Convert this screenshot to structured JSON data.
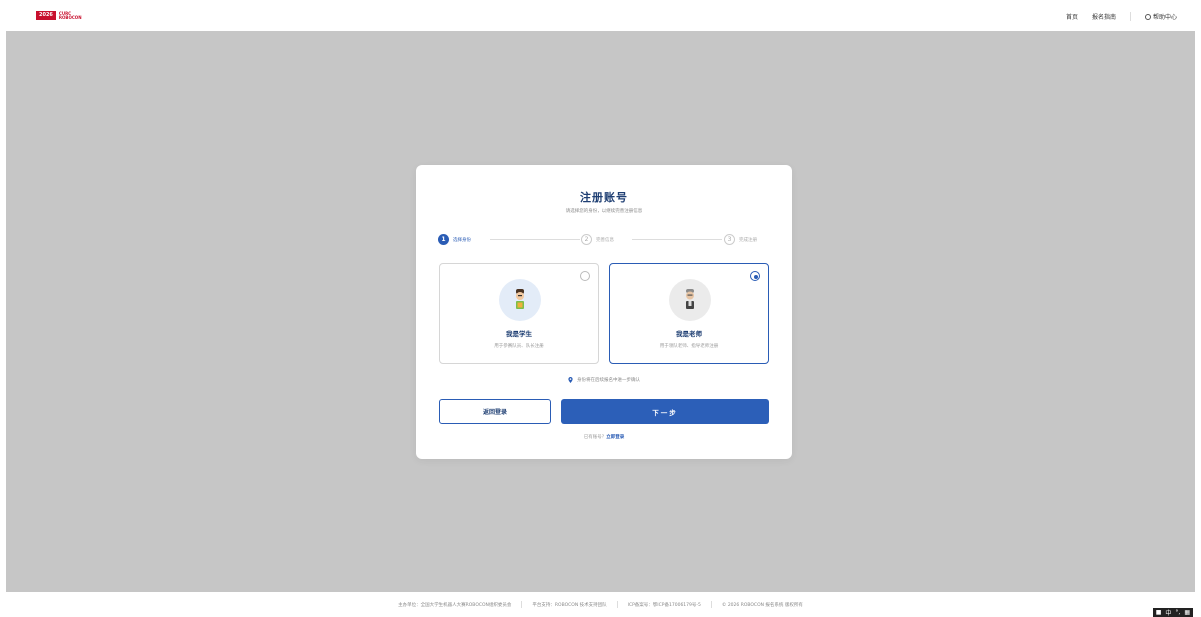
{
  "header": {
    "logo_badge": "2026",
    "logo_line1": "CURC",
    "logo_line2": "ROBOCON",
    "nav": {
      "home": "首页",
      "guide": "报名指南",
      "help": "帮助中心"
    }
  },
  "card": {
    "title": "注册账号",
    "subtitle": "请选择您的身份，以继续完善注册信息",
    "steps": [
      {
        "num": "1",
        "label": "选择身份"
      },
      {
        "num": "2",
        "label": "完善信息"
      },
      {
        "num": "3",
        "label": "完成注册"
      }
    ],
    "roles": {
      "student": {
        "name": "我是学生",
        "desc": "用于参赛队员、队长注册"
      },
      "teacher": {
        "name": "我是老师",
        "desc": "用于领队老师、指导老师注册"
      }
    },
    "selected_role": "teacher",
    "note": "身份将在后续报名中进一步确认",
    "back_button": "返回登录",
    "next_button": "下一步",
    "login_prompt": "已有账号？",
    "login_link": "立即登录"
  },
  "footer": {
    "organizer": "主办单位：全国大学生机器人大赛ROBOCON组织委员会",
    "support": "平台支持：ROBOCON 技术支持团队",
    "icp": "ICP备案号：鄂ICP备17006179号-5",
    "copyright": "© 2026 ROBOCON 报名系统 版权所有"
  },
  "ime": {
    "label": "中"
  },
  "colors": {
    "accent": "#2a5cb5",
    "brand_red": "#c8102e",
    "backdrop": "#c6c6c6"
  }
}
